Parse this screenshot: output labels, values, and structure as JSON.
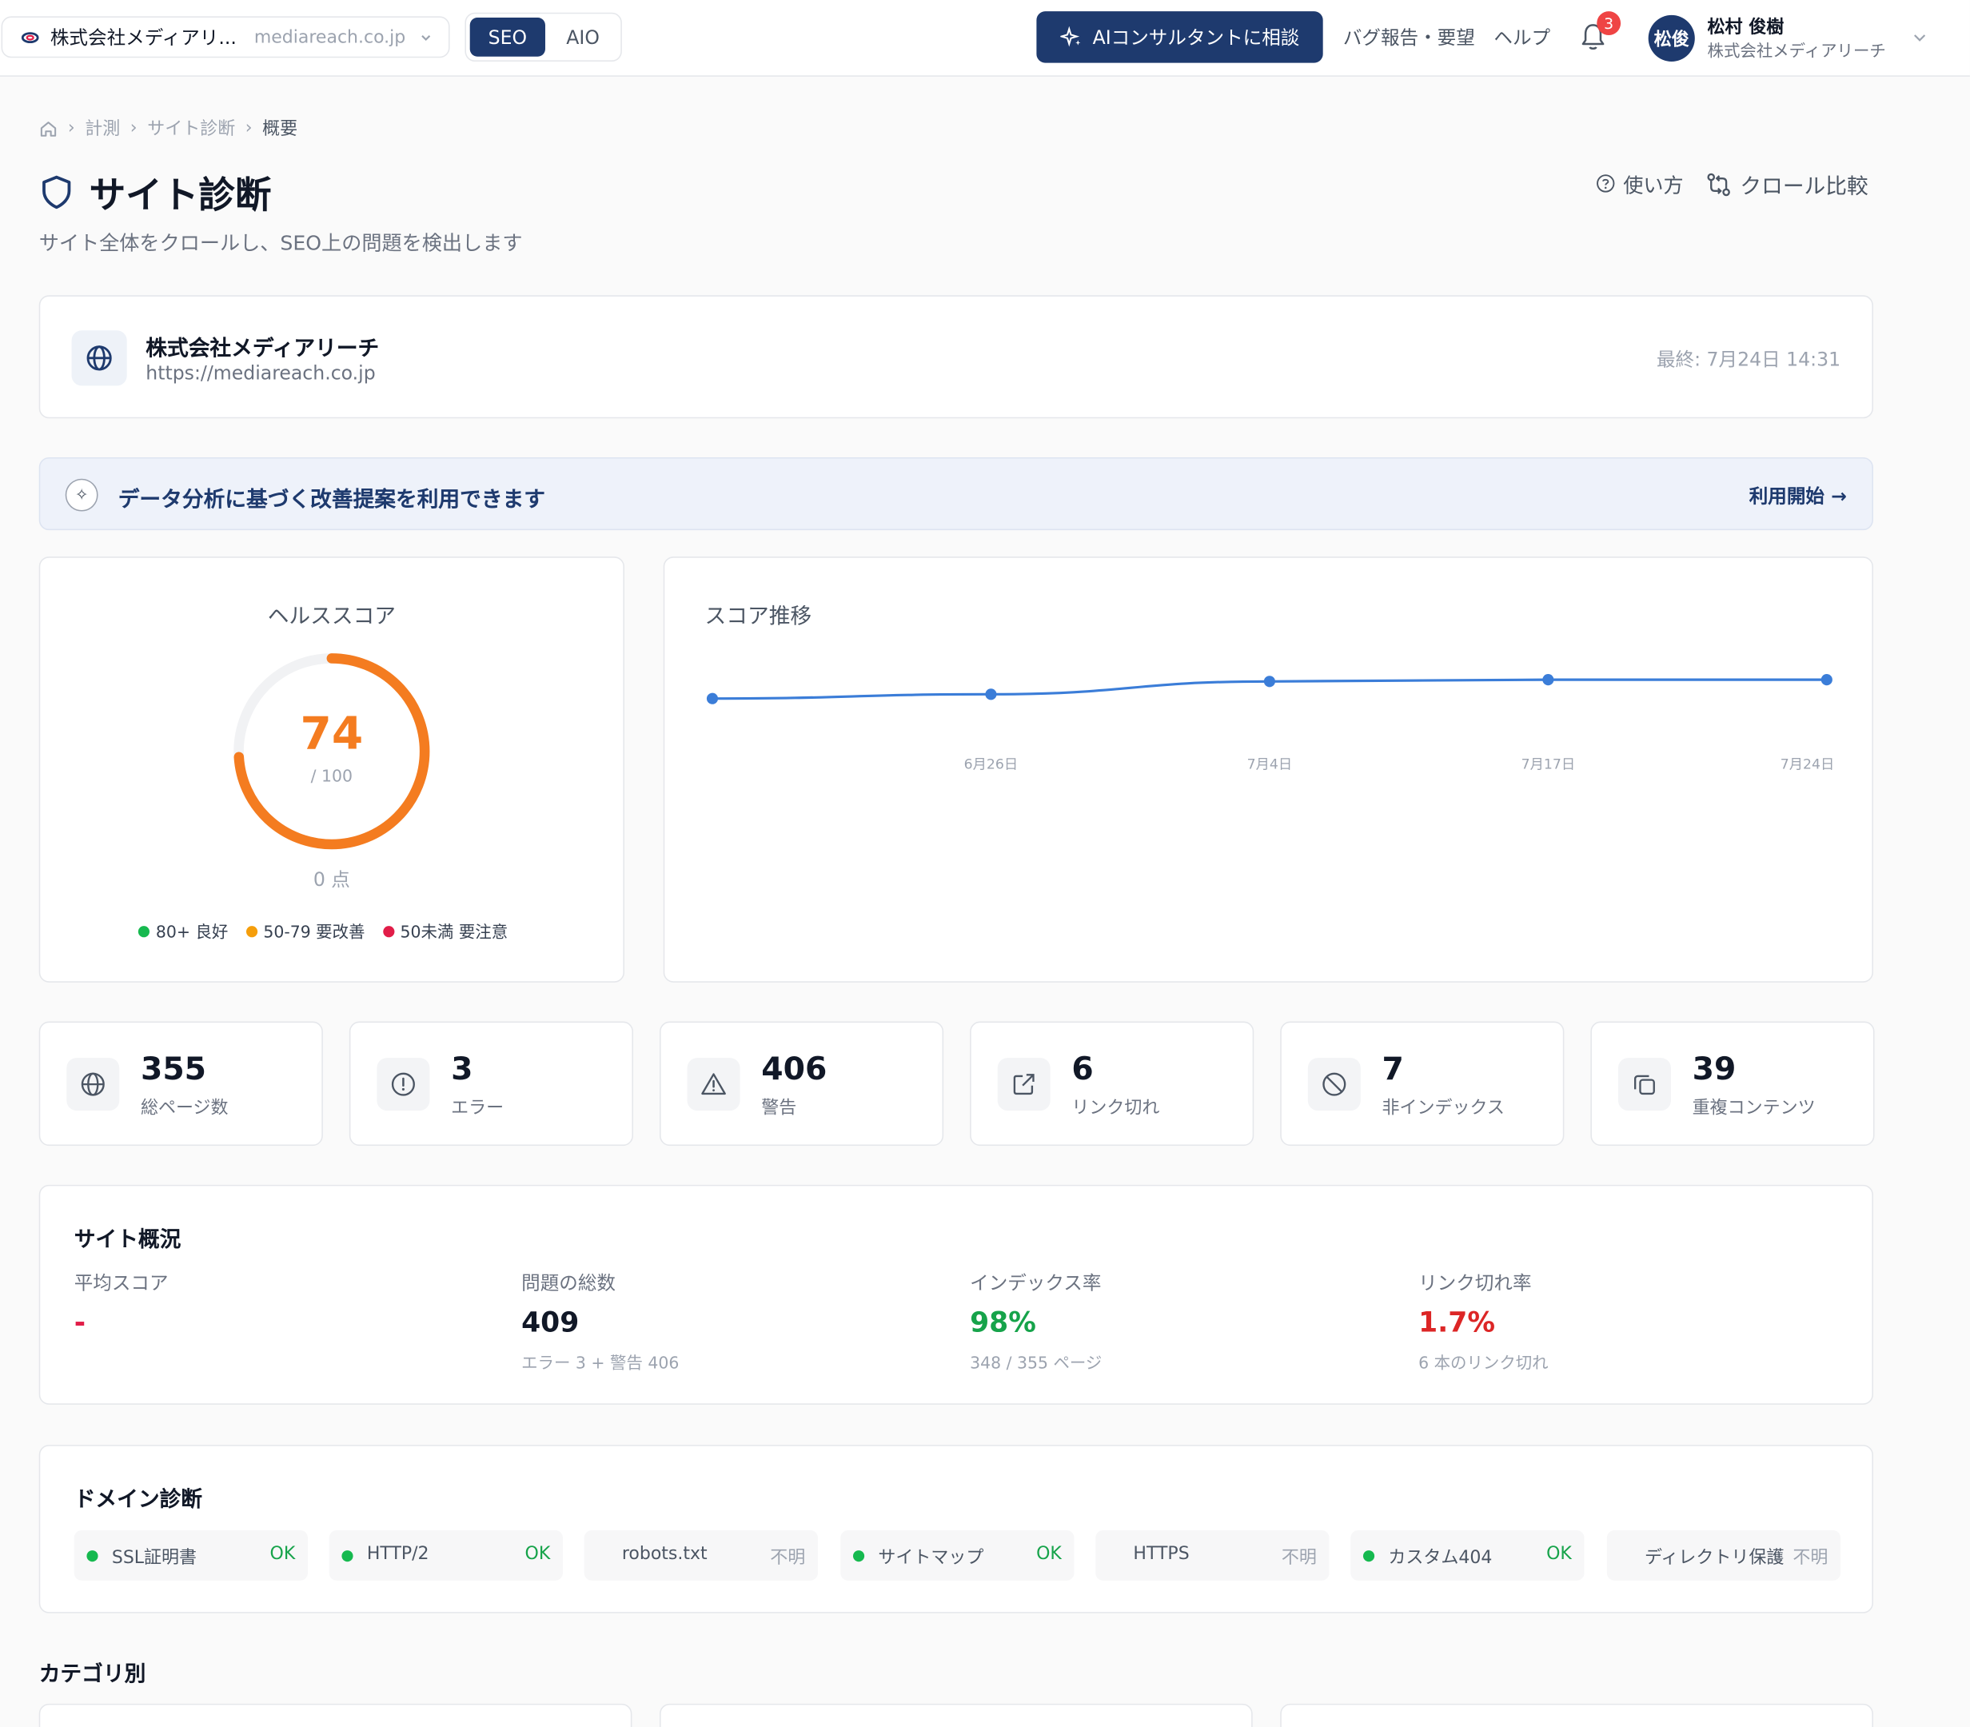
{
  "topbar": {
    "site_name": "株式会社メディアリ...",
    "site_domain": "mediareach.co.jp",
    "tabs": [
      {
        "label": "SEO",
        "active": true
      },
      {
        "label": "AIO",
        "active": false
      }
    ],
    "ai_button": "AIコンサルタントに相談",
    "bug_report": "バグ報告・要望",
    "help": "ヘルプ",
    "notification_count": "3",
    "avatar_initials": "松俊",
    "user_name": "松村 俊樹",
    "user_org": "株式会社メディアリーチ"
  },
  "breadcrumb": [
    "計測",
    "サイト診断",
    "概要"
  ],
  "page": {
    "title": "サイト診断",
    "subtitle": "サイト全体をクロールし、SEO上の問題を検出します",
    "how_to": "使い方",
    "crawl_compare": "クロール比較"
  },
  "site_card": {
    "name": "株式会社メディアリーチ",
    "url": "https://mediareach.co.jp",
    "last_crawl": "最終: 7月24日 14:31"
  },
  "banner": {
    "icon_glyph": "✧",
    "text": "データ分析に基づく改善提案を利用できます",
    "cta": "利用開始 →"
  },
  "health": {
    "title": "ヘルススコア",
    "score": 74,
    "score_text": "74",
    "max_text": "/ 100",
    "points_text": "0 点",
    "legend": [
      {
        "label": "80+ 良好",
        "color": "#16b94f"
      },
      {
        "label": "50-79 要改善",
        "color": "#f59e0b"
      },
      {
        "label": "50未満 要注意",
        "color": "#e11d48"
      }
    ],
    "gauge_color": "#f47c20",
    "track_color": "#f1f2f4"
  },
  "trend": {
    "title": "スコア推移"
  },
  "chart_data": {
    "type": "line",
    "x": [
      "",
      "6月26日",
      "7月4日",
      "7月17日",
      "7月24日"
    ],
    "values": [
      72,
      72.5,
      74,
      74.2,
      74.2
    ],
    "ylim": [
      50,
      80
    ],
    "color": "#3b7dd8",
    "grid": false
  },
  "stats": [
    {
      "value": "355",
      "label": "総ページ数",
      "icon": "globe-icon"
    },
    {
      "value": "3",
      "label": "エラー",
      "icon": "alert-circle-icon"
    },
    {
      "value": "406",
      "label": "警告",
      "icon": "warning-triangle-icon"
    },
    {
      "value": "6",
      "label": "リンク切れ",
      "icon": "external-link-icon"
    },
    {
      "value": "7",
      "label": "非インデックス",
      "icon": "ban-icon"
    },
    {
      "value": "39",
      "label": "重複コンテンツ",
      "icon": "copy-icon"
    }
  ],
  "overview": {
    "title": "サイト概況",
    "cols": [
      {
        "label": "平均スコア",
        "value": "-",
        "sub": "",
        "color": "#e11d48"
      },
      {
        "label": "問題の総数",
        "value": "409",
        "sub": "エラー 3 + 警告 406",
        "color": "#111827"
      },
      {
        "label": "インデックス率",
        "value": "98%",
        "sub": "348 / 355 ページ",
        "color": "#16a34a"
      },
      {
        "label": "リンク切れ率",
        "value": "1.7%",
        "sub": "6 本のリンク切れ",
        "color": "#dc2626"
      }
    ]
  },
  "domain": {
    "title": "ドメイン診断",
    "items": [
      {
        "name": "SSL証明書",
        "status": "OK",
        "ok": true
      },
      {
        "name": "HTTP/2",
        "status": "OK",
        "ok": true
      },
      {
        "name": "robots.txt",
        "status": "不明",
        "ok": false
      },
      {
        "name": "サイトマップ",
        "status": "OK",
        "ok": true
      },
      {
        "name": "HTTPS",
        "status": "不明",
        "ok": false
      },
      {
        "name": "カスタム404",
        "status": "OK",
        "ok": true
      },
      {
        "name": "ディレクトリ保護",
        "status": "不明",
        "ok": false
      }
    ]
  },
  "categories": {
    "title": "カテゴリ別"
  }
}
